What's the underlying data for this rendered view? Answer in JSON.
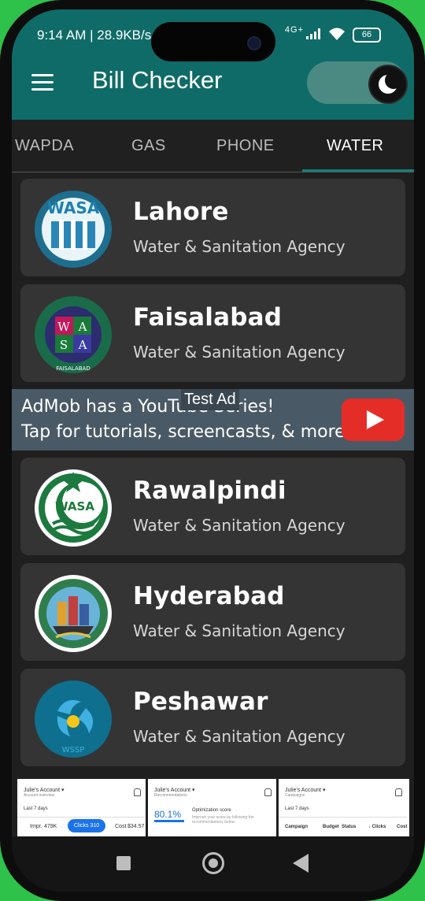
{
  "status_bar": {
    "time_info": "9:14 AM | 28.9KB/s",
    "network": "4G+",
    "signal_icon": "signal-bars-icon",
    "wifi_icon": "wifi-icon",
    "battery": "66"
  },
  "header": {
    "title": "Bill Checker",
    "menu_icon": "hamburger-menu-icon",
    "theme_toggle_icon": "moon-icon",
    "background_color": "#0f6b67"
  },
  "tabs": [
    {
      "label": "WAPDA",
      "active": false
    },
    {
      "label": "GAS",
      "active": false
    },
    {
      "label": "PHONE",
      "active": false
    },
    {
      "label": "WATER",
      "active": true
    }
  ],
  "agencies": [
    {
      "city": "Lahore",
      "subtitle": "Water & Sanitation Agency",
      "logo_text": "WASA"
    },
    {
      "city": "Faisalabad",
      "subtitle": "Water & Sanitation Agency",
      "logo_text": "WASA",
      "logo_ring_text": "WATER AND SANITATION AGENCY",
      "logo_bottom_text": "FAISALABAD"
    },
    {
      "city": "Rawalpindi",
      "subtitle": "Water & Sanitation Agency",
      "logo_text": "WASA"
    },
    {
      "city": "Hyderabad",
      "subtitle": "Water & Sanitation Agency",
      "logo_ring_text": "HYDERABAD DEVELOPMENT AUTHORITY"
    },
    {
      "city": "Peshawar",
      "subtitle": "Water & Sanitation Agency",
      "logo_text": "WSSP"
    }
  ],
  "ad_banner": {
    "line1": "AdMob has a YouTube Series!",
    "line2": "Tap for tutorials, screencasts, & more.",
    "test_label": "Test Ad",
    "play_icon": "youtube-play-icon"
  },
  "bottom_ad": {
    "panels": [
      {
        "account": "Julie's Account ▾",
        "sub": "Account overview",
        "period": "Last 7 days",
        "impr_label": "Impr.",
        "impr_value": "479K",
        "clicks_label": "Clicks",
        "clicks_value": "310",
        "cost_label": "Cost",
        "cost_value": "$34.57"
      },
      {
        "account": "Julie's Account ▾",
        "sub": "Recommendations",
        "score": "80.1%",
        "score_label": "Optimization score",
        "score_note": "Improve your score by following the recommendations below"
      },
      {
        "account": "Julie's Account ▾",
        "sub": "Campaigns",
        "period": "Last 7 days",
        "cols": [
          "Campaign",
          "Budget",
          "Status",
          "↓ Clicks",
          "Cost"
        ]
      }
    ]
  },
  "nav": {
    "recents_icon": "square-recents-icon",
    "home_icon": "circle-home-icon",
    "back_icon": "triangle-back-icon"
  }
}
